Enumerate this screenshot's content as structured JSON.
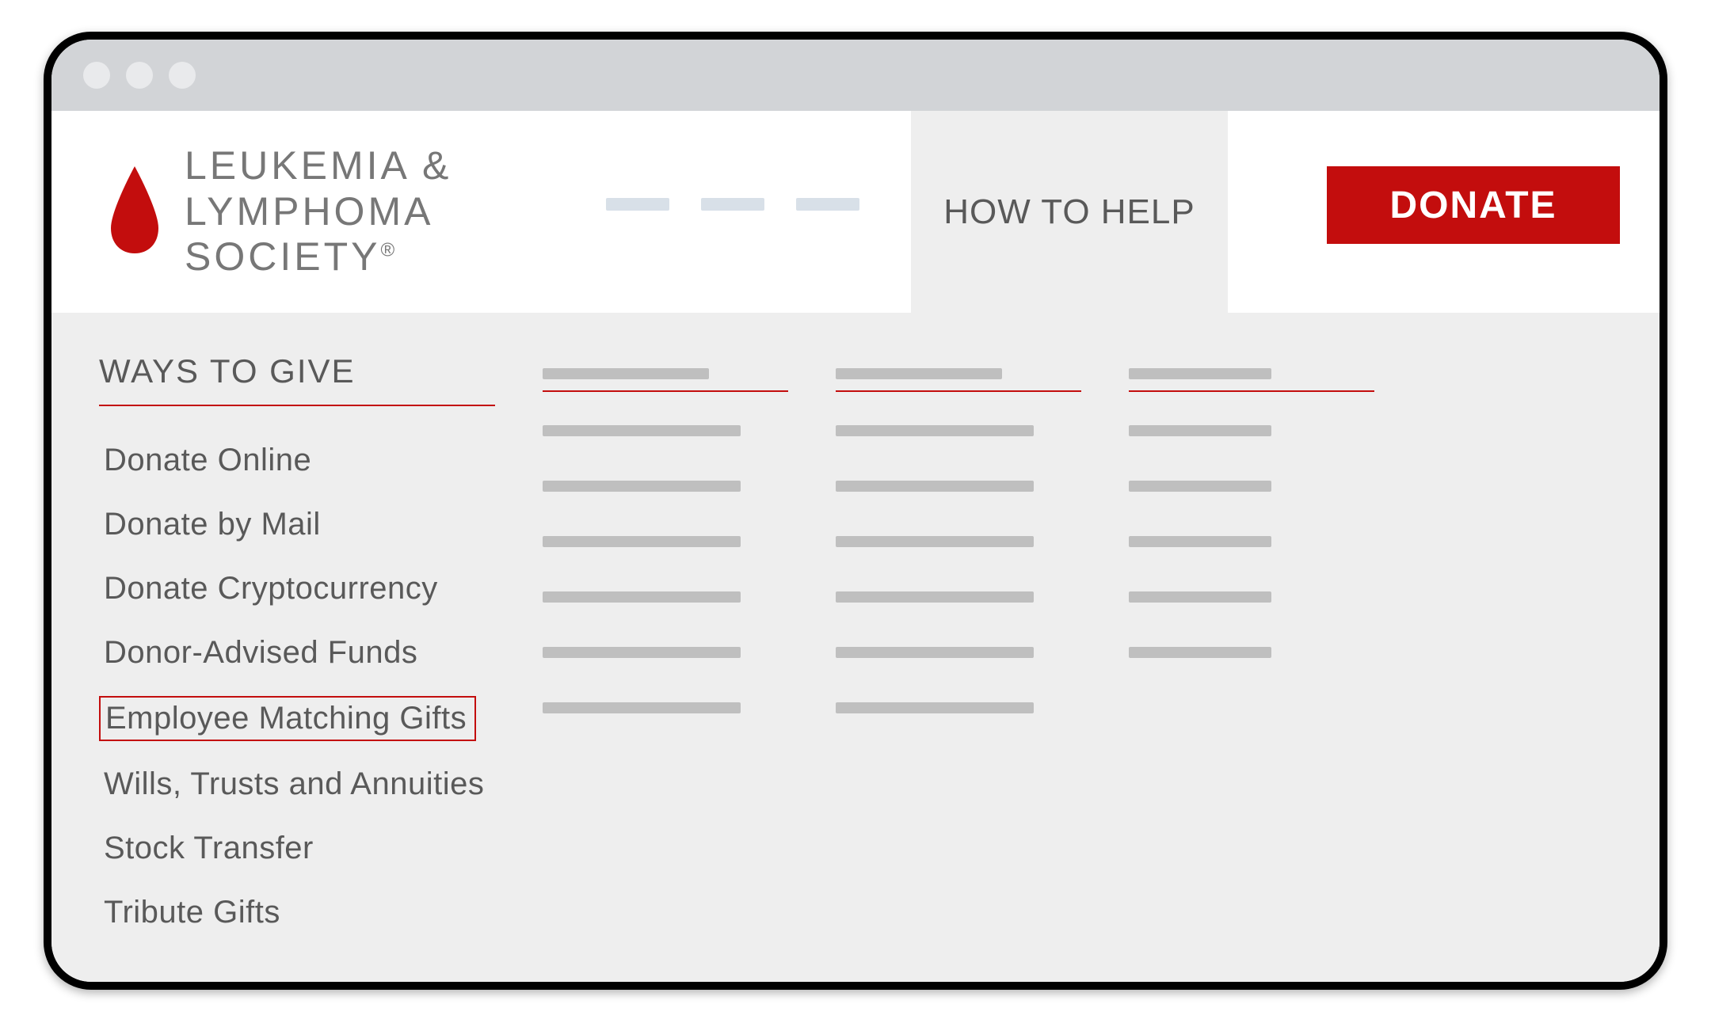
{
  "logo": {
    "line1": "LEUKEMIA &",
    "line2": "LYMPHOMA",
    "line3": "SOCIETY"
  },
  "nav": {
    "active_item": "HOW TO HELP",
    "donate_label": "DONATE"
  },
  "menu": {
    "heading": "WAYS TO GIVE",
    "items": [
      "Donate Online",
      "Donate by Mail",
      "Donate Cryptocurrency",
      "Donor-Advised Funds",
      "Employee Matching Gifts",
      "Wills, Trusts and Annuities",
      "Stock Transfer",
      "Tribute Gifts"
    ],
    "highlighted_index": 4
  }
}
